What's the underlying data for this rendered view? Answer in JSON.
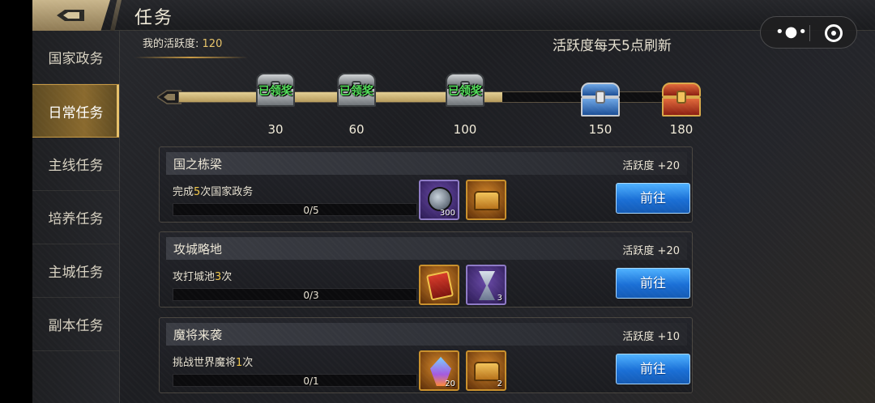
{
  "header": {
    "title": "任务"
  },
  "capsule": {
    "more_glyph": "•●•"
  },
  "sidebar": {
    "items": [
      {
        "label": "国家政务",
        "active": false
      },
      {
        "label": "日常任务",
        "active": true
      },
      {
        "label": "主线任务",
        "active": false
      },
      {
        "label": "培养任务",
        "active": false
      },
      {
        "label": "主城任务",
        "active": false
      },
      {
        "label": "副本任务",
        "active": false
      }
    ]
  },
  "activity": {
    "label": "我的活跃度:",
    "value": "120",
    "refresh_note": "活跃度每天5点刷新"
  },
  "milestones": [
    {
      "value": "30",
      "claimed": true,
      "claimed_label": "已领奖",
      "chest": "silver"
    },
    {
      "value": "60",
      "claimed": true,
      "claimed_label": "已领奖",
      "chest": "silver"
    },
    {
      "value": "100",
      "claimed": true,
      "claimed_label": "已领奖",
      "chest": "silver"
    },
    {
      "value": "150",
      "claimed": false,
      "chest": "blue"
    },
    {
      "value": "180",
      "claimed": false,
      "chest": "red"
    }
  ],
  "progress_fraction": 0.625,
  "tasks": [
    {
      "title": "国之栋梁",
      "points": "活跃度 +20",
      "desc_prefix": "完成",
      "desc_num": "5",
      "desc_suffix": "次国家政务",
      "count": "0/5",
      "progress": 0,
      "rewards": [
        {
          "icon": "emblem",
          "qty": "300",
          "color": "purple"
        },
        {
          "icon": "treasure",
          "qty": "",
          "color": "orange"
        }
      ],
      "button": "前往"
    },
    {
      "title": "攻城略地",
      "points": "活跃度 +20",
      "desc_prefix": "攻打城池",
      "desc_num": "3",
      "desc_suffix": "次",
      "count": "0/3",
      "progress": 0,
      "rewards": [
        {
          "icon": "scroll",
          "qty": "",
          "color": "orange"
        },
        {
          "icon": "hourglass",
          "qty": "3",
          "color": "purple"
        }
      ],
      "button": "前往"
    },
    {
      "title": "魔将来袭",
      "points": "活跃度 +10",
      "desc_prefix": "挑战世界魔将",
      "desc_num": "1",
      "desc_suffix": "次",
      "count": "0/1",
      "progress": 0,
      "rewards": [
        {
          "icon": "crystal",
          "qty": "20",
          "color": "orange"
        },
        {
          "icon": "treasure",
          "qty": "2",
          "color": "orange"
        }
      ],
      "button": "前往"
    }
  ]
}
